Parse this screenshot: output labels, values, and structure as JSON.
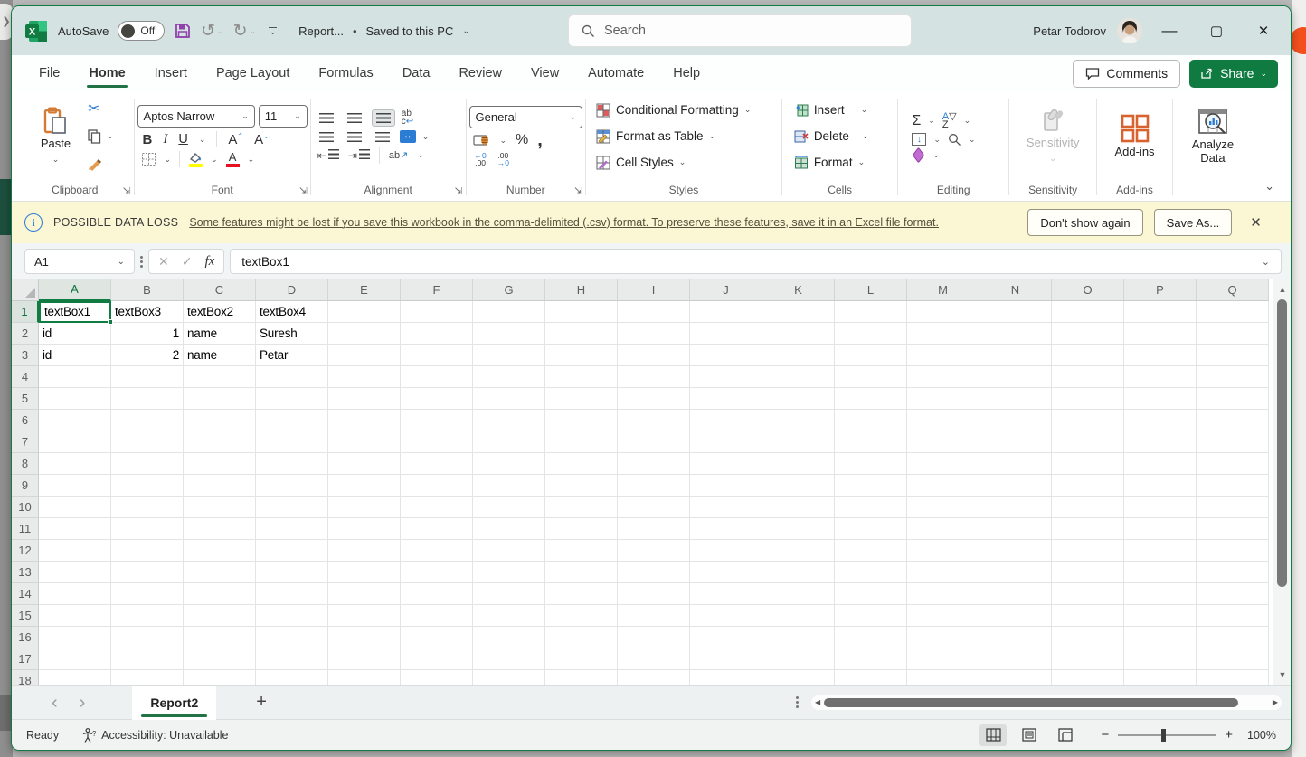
{
  "colors": {
    "accent_green": "#107c41",
    "titlebar_bg": "#d4e2e1",
    "warning_bg": "#fbf6d4",
    "share_green": "#0f7b41"
  },
  "titlebar": {
    "autosave_label": "AutoSave",
    "autosave_state": "Off",
    "doc_title": "Report...",
    "dot": "•",
    "saved_status": "Saved to this PC",
    "search_placeholder": "Search",
    "user_name": "Petar Todorov",
    "minimize": "—",
    "maximize": "▢",
    "close": "✕"
  },
  "menubar": {
    "tabs": [
      {
        "label": "File"
      },
      {
        "label": "Home",
        "active": true
      },
      {
        "label": "Insert"
      },
      {
        "label": "Page Layout"
      },
      {
        "label": "Formulas"
      },
      {
        "label": "Data"
      },
      {
        "label": "Review"
      },
      {
        "label": "View"
      },
      {
        "label": "Automate"
      },
      {
        "label": "Help"
      }
    ],
    "comments_label": "Comments",
    "share_label": "Share"
  },
  "ribbon": {
    "clipboard": {
      "label": "Clipboard",
      "paste_label": "Paste"
    },
    "font": {
      "label": "Font",
      "font_name": "Aptos Narrow",
      "font_size": "11",
      "bold": "B",
      "italic": "I",
      "underline": "U"
    },
    "alignment": {
      "label": "Alignment"
    },
    "number": {
      "label": "Number",
      "format": "General"
    },
    "styles": {
      "label": "Styles",
      "items": [
        "Conditional Formatting",
        "Format as Table",
        "Cell Styles"
      ]
    },
    "cells": {
      "label": "Cells",
      "items": [
        "Insert",
        "Delete",
        "Format"
      ]
    },
    "editing": {
      "label": "Editing"
    },
    "sensitivity": {
      "label": "Sensitivity",
      "button": "Sensitivity"
    },
    "addins": {
      "label": "Add-ins",
      "button": "Add-ins"
    },
    "analyze": {
      "button": "Analyze Data"
    }
  },
  "warning": {
    "title": "POSSIBLE DATA LOSS",
    "message": "Some features might be lost if you save this workbook in the comma-delimited (.csv) format. To preserve these features, save it in an Excel file format.",
    "dismiss_label": "Don't show again",
    "saveas_label": "Save As...",
    "close": "✕"
  },
  "formula_bar": {
    "name_box": "A1",
    "cancel": "✕",
    "enter": "✓",
    "fx": "fx",
    "formula": "textBox1"
  },
  "grid": {
    "columns": [
      "A",
      "B",
      "C",
      "D",
      "E",
      "F",
      "G",
      "H",
      "I",
      "J",
      "K",
      "L",
      "M",
      "N",
      "O",
      "P",
      "Q"
    ],
    "visible_rows": 18,
    "selected_cell": "A1",
    "selected_column": "A",
    "selected_row": 1,
    "rows": [
      [
        "textBox1",
        "textBox3",
        "textBox2",
        "textBox4"
      ],
      [
        "id",
        "1",
        "name",
        "Suresh"
      ],
      [
        "id",
        "2",
        "name",
        "Petar"
      ]
    ],
    "right_aligned": [
      "B2",
      "B3"
    ]
  },
  "sheetbar": {
    "active_sheet": "Report2",
    "add_sheet": "+"
  },
  "statusbar": {
    "mode": "Ready",
    "accessibility": "Accessibility: Unavailable",
    "zoom_level": "100%",
    "zoom_minus": "−",
    "zoom_plus": "+"
  }
}
